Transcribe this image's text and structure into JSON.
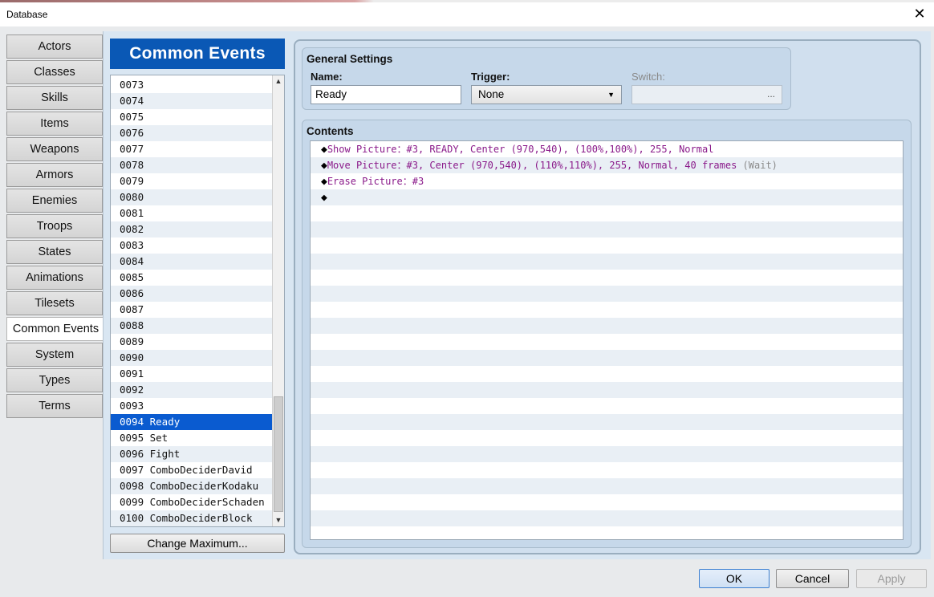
{
  "window": {
    "title": "Database",
    "close_glyph": "✕"
  },
  "tabs": [
    {
      "label": "Actors"
    },
    {
      "label": "Classes"
    },
    {
      "label": "Skills"
    },
    {
      "label": "Items"
    },
    {
      "label": "Weapons"
    },
    {
      "label": "Armors"
    },
    {
      "label": "Enemies"
    },
    {
      "label": "Troops"
    },
    {
      "label": "States"
    },
    {
      "label": "Animations"
    },
    {
      "label": "Tilesets"
    },
    {
      "label": "Common Events",
      "active": true
    },
    {
      "label": "System"
    },
    {
      "label": "Types"
    },
    {
      "label": "Terms"
    }
  ],
  "event_list": {
    "header": "Common Events",
    "items": [
      "0073",
      "0074",
      "0075",
      "0076",
      "0077",
      "0078",
      "0079",
      "0080",
      "0081",
      "0082",
      "0083",
      "0084",
      "0085",
      "0086",
      "0087",
      "0088",
      "0089",
      "0090",
      "0091",
      "0092",
      "0093",
      "0094 Ready",
      "0095 Set",
      "0096 Fight",
      "0097 ComboDeciderDavid",
      "0098 ComboDeciderKodaku",
      "0099 ComboDeciderSchaden",
      "0100 ComboDeciderBlock"
    ],
    "selected": "0094 Ready",
    "change_max_label": "Change Maximum..."
  },
  "general_settings": {
    "title": "General Settings",
    "name_label": "Name:",
    "name_value": "Ready",
    "trigger_label": "Trigger:",
    "trigger_value": "None",
    "switch_label": "Switch:",
    "switch_button": "..."
  },
  "contents": {
    "title": "Contents",
    "commands": [
      {
        "text": "Show Picture：#3, READY, Center (970,540), (100%,100%), 255, Normal",
        "suffix": ""
      },
      {
        "text": "Move Picture：#3, Center (970,540), (110%,110%), 255, Normal, 40 frames",
        "suffix": " (Wait)"
      },
      {
        "text": "Erase Picture：#3",
        "suffix": ""
      },
      {
        "text": "",
        "suffix": ""
      }
    ],
    "empty_rows": 21,
    "bullet": "◆"
  },
  "footer": {
    "ok": "OK",
    "cancel": "Cancel",
    "apply": "Apply"
  },
  "colors": {
    "accent": "#0a58b5",
    "selection": "#0a5bd0",
    "command_text": "#8a1a8a"
  }
}
